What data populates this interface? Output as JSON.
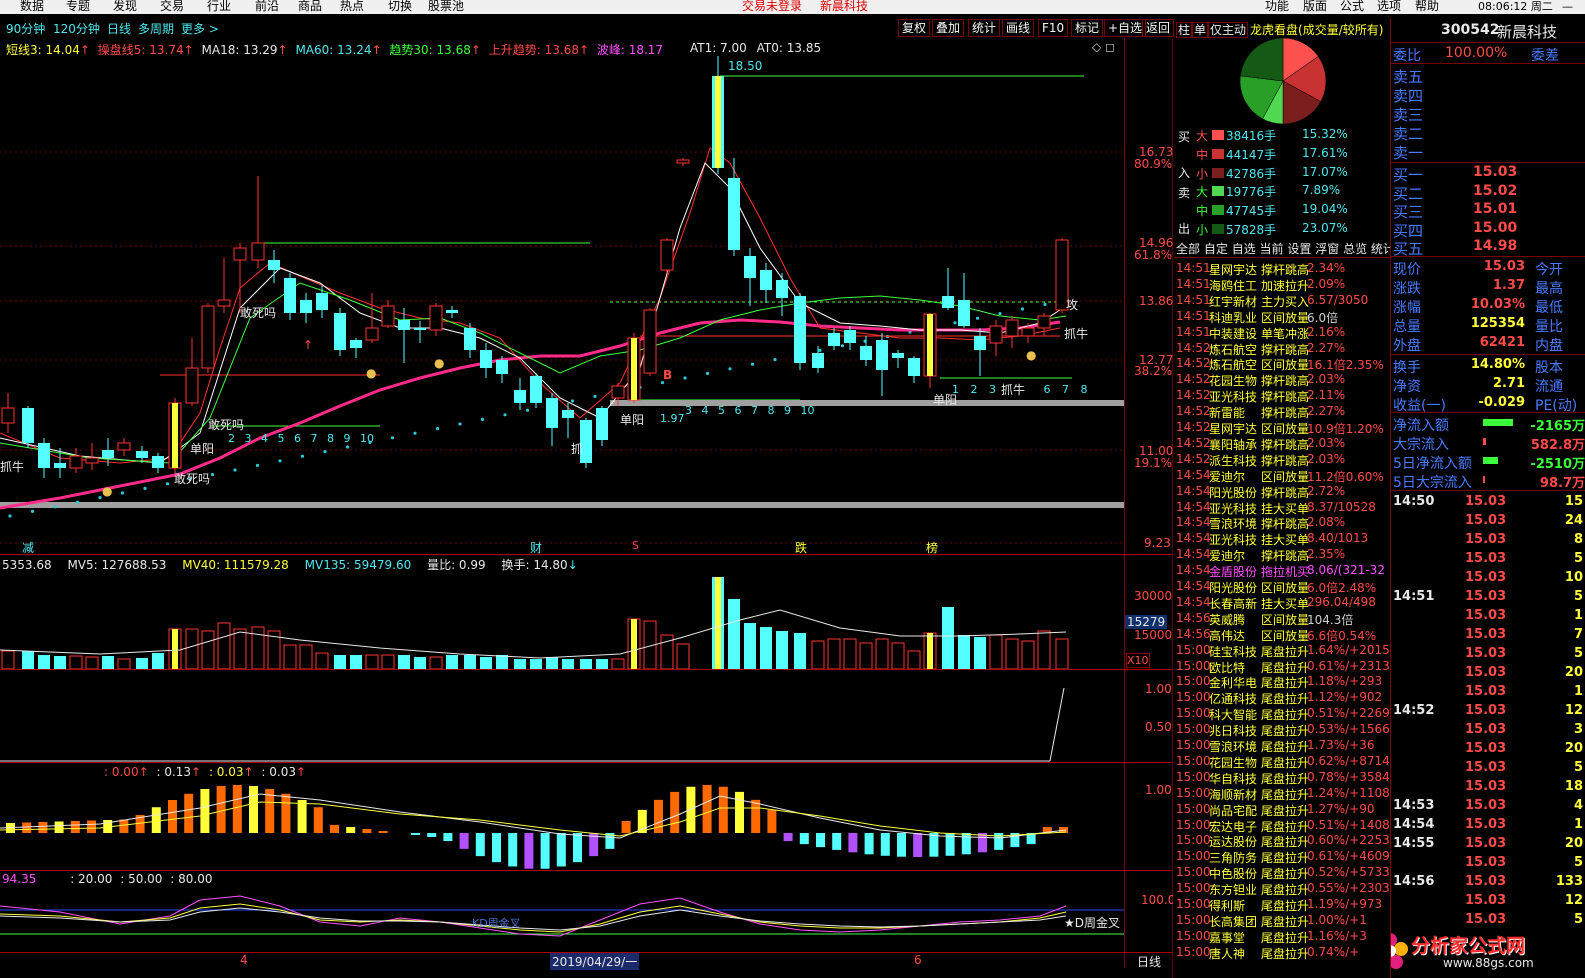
{
  "menubar": {
    "items": [
      "数据",
      "专题",
      "发现",
      "交易",
      "行业",
      "前沿",
      "商品",
      "热点",
      "切换",
      "股票池"
    ],
    "center": [
      "交易未登录",
      "新晨科技"
    ],
    "right": [
      "功能",
      "版面",
      "公式",
      "选项",
      "帮助"
    ],
    "clock": "08:06:12 周二"
  },
  "toolbar": {
    "periods": [
      "90分钟",
      "120分钟",
      "日线",
      "多周期",
      "更多 >"
    ],
    "buttons": [
      "复权",
      "叠加",
      "统计",
      "画线",
      "F10",
      "标记",
      "+自选",
      "返回"
    ]
  },
  "indicators": {
    "main": [
      "短线3: 14.04",
      "操盘线5: 13.74",
      "MA18: 13.29",
      "MA60: 13.24",
      "趋势30: 13.68",
      "上升趋势: 13.68",
      "波峰: 18.17",
      "AT1: 7.00",
      "AT0: 13.85"
    ],
    "volume": [
      "5353.68",
      "MV5: 127688.53",
      "MV40: 111579.28",
      "MV135: 59479.60",
      "量比: 0.99",
      "换手: 14.80"
    ],
    "macd": [
      ": 0.00",
      ": 0.13",
      ": 0.03",
      ": 0.03"
    ],
    "kdj": [
      "94.35",
      ": 20.00",
      ": 50.00",
      ": 80.00"
    ]
  },
  "price_axis": {
    "labels": [
      "16.73",
      "80.9%",
      "14.96",
      "61.8%",
      "13.86",
      "12.77",
      "38.2%",
      "11.00",
      "19.1%",
      "9.23"
    ],
    "volume_labels": [
      "30000",
      "15279",
      "15000",
      "X10"
    ],
    "ind1_labels": [
      "1.00",
      "0.50"
    ],
    "macd_labels": [
      "1.00"
    ],
    "kdj_labels": [
      "100.0"
    ]
  },
  "chart_annotations": {
    "top_price": "18.50",
    "b_marker": "B",
    "count_seq_1": [
      "2",
      "3",
      "4",
      "5",
      "6",
      "7",
      "8",
      "9",
      "10"
    ],
    "count_seq_2": [
      "3",
      "4",
      "5",
      "6",
      "7",
      "8",
      "9",
      "10"
    ],
    "count_seq_3": [
      "1",
      "2",
      "3",
      "6",
      "7",
      "8"
    ],
    "small_num": "1.97",
    "words": [
      "抓牛",
      "敢死吗",
      "敢死吗",
      "敢死吗",
      "单阳",
      "单阳",
      "抓",
      "单阳",
      "抓牛",
      "抓牛",
      "攻"
    ],
    "bottom_tags": [
      "减",
      "财",
      "S",
      "跌",
      "榜"
    ],
    "kd_cross": "KD周金叉",
    "kd_cross2": "★D周金叉"
  },
  "date_axis": {
    "labels": [
      "4",
      "2019/04/29/一",
      "6"
    ],
    "period": "日线"
  },
  "side_tabs": [
    "柱",
    "单",
    "仅主动",
    "龙虎看盘(成交量/较所有)"
  ],
  "order_flow": {
    "buy": {
      "label": [
        "买",
        "入"
      ],
      "rows": [
        {
          "size": "大",
          "vol": "38416手",
          "pct": "15.32%"
        },
        {
          "size": "中",
          "vol": "44147手",
          "pct": "17.61%"
        },
        {
          "size": "小",
          "vol": "42786手",
          "pct": "17.07%"
        }
      ]
    },
    "sell": {
      "label": [
        "卖",
        "出"
      ],
      "rows": [
        {
          "size": "大",
          "vol": "19776手",
          "pct": "7.89%"
        },
        {
          "size": "中",
          "vol": "47745手",
          "pct": "19.04%"
        },
        {
          "size": "小",
          "vol": "57828手",
          "pct": "23.07%"
        }
      ]
    }
  },
  "pie_data": {
    "slices": [
      {
        "name": "买大",
        "value": 15.32,
        "color": "#ff5050"
      },
      {
        "name": "买中",
        "value": 17.61,
        "color": "#c83232"
      },
      {
        "name": "买小",
        "value": 17.07,
        "color": "#7a1e1e"
      },
      {
        "name": "卖大",
        "value": 7.89,
        "color": "#50d850"
      },
      {
        "name": "卖中",
        "value": 19.04,
        "color": "#28a028"
      },
      {
        "name": "卖小",
        "value": 23.07,
        "color": "#145a14"
      }
    ]
  },
  "filter_tabs": [
    "全部",
    "自定",
    "自选",
    "当前",
    "设置",
    "浮窗",
    "总览",
    "统计"
  ],
  "radar": [
    {
      "t": "14:51",
      "name": "星网宇达",
      "act": "撑杆跳高",
      "val": "2.34%",
      "c": "red"
    },
    {
      "t": "14:51",
      "name": "海鸥住工",
      "act": "加速拉升",
      "val": "2.09%",
      "c": "red"
    },
    {
      "t": "14:51",
      "name": "红宇新材",
      "act": "主力买入",
      "val": "6.57/3050",
      "c": "red"
    },
    {
      "t": "14:51",
      "name": "科迪乳业",
      "act": "区间放量",
      "val": "6.0倍",
      "c": "gray"
    },
    {
      "t": "14:51",
      "name": "中装建设",
      "act": "单笔冲涨",
      "val": "2.16%",
      "c": "red"
    },
    {
      "t": "14:52",
      "name": "炼石航空",
      "act": "撑杆跳高",
      "val": "2.27%",
      "c": "red"
    },
    {
      "t": "14:52",
      "name": "炼石航空",
      "act": "区间放量",
      "val": "16.1倍2.35%",
      "c": "red"
    },
    {
      "t": "14:52",
      "name": "花园生物",
      "act": "撑杆跳高",
      "val": "2.03%",
      "c": "red"
    },
    {
      "t": "14:52",
      "name": "亚光科技",
      "act": "撑杆跳高",
      "val": "2.11%",
      "c": "red"
    },
    {
      "t": "14:52",
      "name": "新雷能",
      "act": "撑杆跳高",
      "val": "2.27%",
      "c": "red"
    },
    {
      "t": "14:52",
      "name": "星网宇达",
      "act": "区间放量",
      "val": "10.9倍1.20%",
      "c": "red"
    },
    {
      "t": "14:52",
      "name": "襄阳轴承",
      "act": "撑杆跳高",
      "val": "2.03%",
      "c": "red"
    },
    {
      "t": "14:52",
      "name": "派生科技",
      "act": "撑杆跳高",
      "val": "2.03%",
      "c": "red"
    },
    {
      "t": "14:54",
      "name": "爱迪尔",
      "act": "区间放量",
      "val": "11.2倍0.60%",
      "c": "red"
    },
    {
      "t": "14:54",
      "name": "阳光股份",
      "act": "撑杆跳高",
      "val": "2.72%",
      "c": "red"
    },
    {
      "t": "14:54",
      "name": "亚光科技",
      "act": "挂大买单",
      "val": "8.37/10528",
      "c": "red"
    },
    {
      "t": "14:54",
      "name": "雪浪环境",
      "act": "撑杆跳高",
      "val": "2.08%",
      "c": "red"
    },
    {
      "t": "14:54",
      "name": "亚光科技",
      "act": "挂大买单",
      "val": "8.40/1013",
      "c": "red"
    },
    {
      "t": "14:54",
      "name": "爱迪尔",
      "act": "撑杆跳高",
      "val": "2.35%",
      "c": "red"
    },
    {
      "t": "14:54",
      "name": "金盾股份",
      "act": "拖拉机买",
      "val": "8.06/(321-32",
      "c": "magenta"
    },
    {
      "t": "14:54",
      "name": "阳光股份",
      "act": "区间放量",
      "val": "6.0倍2.48%",
      "c": "red"
    },
    {
      "t": "14:54",
      "name": "长春高新",
      "act": "挂大买单",
      "val": "296.04/498",
      "c": "red"
    },
    {
      "t": "14:56",
      "name": "英威腾",
      "act": "区间放量",
      "val": "104.3倍",
      "c": "gray"
    },
    {
      "t": "14:56",
      "name": "高伟达",
      "act": "区间放量",
      "val": "6.6倍0.54%",
      "c": "red"
    },
    {
      "t": "15:00",
      "name": "硅宝科技",
      "act": "尾盘拉升",
      "val": "1.64%/+2015",
      "c": "red"
    },
    {
      "t": "15:00",
      "name": "欧比特",
      "act": "尾盘拉升",
      "val": "0.61%/+2313",
      "c": "red"
    },
    {
      "t": "15:00",
      "name": "金利华电",
      "act": "尾盘拉升",
      "val": "1.18%/+293",
      "c": "red"
    },
    {
      "t": "15:00",
      "name": "亿通科技",
      "act": "尾盘拉升",
      "val": "1.12%/+902",
      "c": "red"
    },
    {
      "t": "15:00",
      "name": "科大智能",
      "act": "尾盘拉升",
      "val": "0.51%/+2269",
      "c": "red"
    },
    {
      "t": "15:00",
      "name": "兆日科技",
      "act": "尾盘拉升",
      "val": "0.53%/+1566",
      "c": "red"
    },
    {
      "t": "15:00",
      "name": "雪浪环境",
      "act": "尾盘拉升",
      "val": "1.73%/+36",
      "c": "red"
    },
    {
      "t": "15:00",
      "name": "花园生物",
      "act": "尾盘拉升",
      "val": "0.62%/+8714",
      "c": "red"
    },
    {
      "t": "15:00",
      "name": "华自科技",
      "act": "尾盘拉升",
      "val": "0.78%/+3584",
      "c": "red"
    },
    {
      "t": "15:00",
      "name": "海顺新材",
      "act": "尾盘拉升",
      "val": "1.24%/+1108",
      "c": "red"
    },
    {
      "t": "15:00",
      "name": "尚品宅配",
      "act": "尾盘拉升",
      "val": "1.27%/+90",
      "c": "red"
    },
    {
      "t": "15:00",
      "name": "宏达电子",
      "act": "尾盘拉升",
      "val": "0.51%/+1408",
      "c": "red"
    },
    {
      "t": "15:00",
      "name": "运达股份",
      "act": "尾盘拉升",
      "val": "0.60%/+2253",
      "c": "red"
    },
    {
      "t": "15:00",
      "name": "三角防务",
      "act": "尾盘拉升",
      "val": "0.61%/+4609",
      "c": "red"
    },
    {
      "t": "15:00",
      "name": "中色股份",
      "act": "尾盘拉升",
      "val": "0.52%/+5733",
      "c": "red"
    },
    {
      "t": "15:00",
      "name": "东方钽业",
      "act": "尾盘拉升",
      "val": "0.55%/+2303",
      "c": "red"
    },
    {
      "t": "15:00",
      "name": "得利斯",
      "act": "尾盘拉升",
      "val": "1.19%/+973",
      "c": "red"
    },
    {
      "t": "15:00",
      "name": "长高集团",
      "act": "尾盘拉升",
      "val": "1.00%/+1",
      "c": "red"
    },
    {
      "t": "15:00",
      "name": "嘉事堂",
      "act": "尾盘拉升",
      "val": "1.16%/+3",
      "c": "red"
    },
    {
      "t": "15:00",
      "name": "唐人神",
      "act": "尾盘拉升",
      "val": "0.74%/+",
      "c": "red"
    }
  ],
  "quote": {
    "code": "300542",
    "name": "新晨科技",
    "weibi_label": "委比",
    "weibi": "100.00%",
    "weicha_label": "委差",
    "asks": [
      "卖五",
      "卖四",
      "卖三",
      "卖二",
      "卖一"
    ],
    "bids": [
      {
        "label": "买一",
        "price": "15.03"
      },
      {
        "label": "买二",
        "price": "15.02"
      },
      {
        "label": "买三",
        "price": "15.01"
      },
      {
        "label": "买四",
        "price": "15.00"
      },
      {
        "label": "买五",
        "price": "14.98"
      }
    ],
    "stats": [
      {
        "k": "现价",
        "v": "15.03",
        "k2": "今开",
        "c": "red"
      },
      {
        "k": "涨跌",
        "v": "1.37",
        "k2": "最高",
        "c": "red"
      },
      {
        "k": "涨幅",
        "v": "10.03%",
        "k2": "最低",
        "c": "red"
      },
      {
        "k": "总量",
        "v": "125354",
        "k2": "量比",
        "c": "yellow"
      },
      {
        "k": "外盘",
        "v": "62421",
        "k2": "内盘",
        "c": "red"
      }
    ],
    "stats2": [
      {
        "k": "换手",
        "v": "14.80%",
        "k2": "股本",
        "c": "yellow"
      },
      {
        "k": "净资",
        "v": "2.71",
        "k2": "流通",
        "c": "yellow"
      },
      {
        "k": "收益(一)",
        "v": "-0.029",
        "k2": "PE(动)",
        "c": "yellow"
      }
    ],
    "flows": [
      {
        "k": "净流入额",
        "v": "-2165万",
        "c": "green",
        "bar": 60
      },
      {
        "k": "大宗流入",
        "v": "582.8万",
        "c": "red",
        "bar": 6
      },
      {
        "k": "5日净流入额",
        "v": "-2510万",
        "c": "green",
        "bar": 30
      },
      {
        "k": "5日大宗流入",
        "v": "98.7万",
        "c": "red",
        "bar": 4
      }
    ]
  },
  "ticks": [
    {
      "t": "14:50",
      "p": "15.03",
      "v": "15"
    },
    {
      "t": "",
      "p": "15.03",
      "v": "24"
    },
    {
      "t": "",
      "p": "15.03",
      "v": "8"
    },
    {
      "t": "",
      "p": "15.03",
      "v": "5"
    },
    {
      "t": "",
      "p": "15.03",
      "v": "10"
    },
    {
      "t": "14:51",
      "p": "15.03",
      "v": "5"
    },
    {
      "t": "",
      "p": "15.03",
      "v": "1"
    },
    {
      "t": "",
      "p": "15.03",
      "v": "7"
    },
    {
      "t": "",
      "p": "15.03",
      "v": "5"
    },
    {
      "t": "",
      "p": "15.03",
      "v": "20"
    },
    {
      "t": "",
      "p": "15.03",
      "v": "1"
    },
    {
      "t": "14:52",
      "p": "15.03",
      "v": "12"
    },
    {
      "t": "",
      "p": "15.03",
      "v": "3"
    },
    {
      "t": "",
      "p": "15.03",
      "v": "20"
    },
    {
      "t": "",
      "p": "15.03",
      "v": "5"
    },
    {
      "t": "",
      "p": "15.03",
      "v": "18"
    },
    {
      "t": "14:53",
      "p": "15.03",
      "v": "4"
    },
    {
      "t": "14:54",
      "p": "15.03",
      "v": "1"
    },
    {
      "t": "14:55",
      "p": "15.03",
      "v": "20"
    },
    {
      "t": "",
      "p": "15.03",
      "v": "5"
    },
    {
      "t": "14:56",
      "p": "15.03",
      "v": "133"
    },
    {
      "t": "",
      "p": "15.03",
      "v": "12"
    },
    {
      "t": "",
      "p": "15.03",
      "v": "5"
    }
  ],
  "watermark": {
    "text": "分析家公式网",
    "url": "www.88gs.com"
  }
}
